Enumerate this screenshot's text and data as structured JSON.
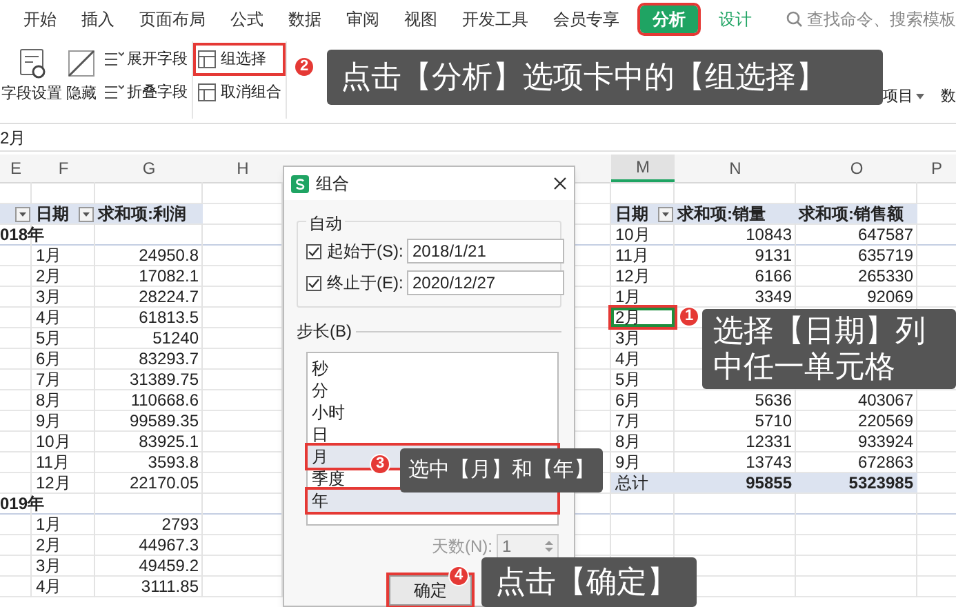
{
  "ribbon_tabs": [
    {
      "label": "开始",
      "kind": "tab",
      "selected": false,
      "highlighted": false
    },
    {
      "label": "插入",
      "kind": "tab",
      "selected": false,
      "highlighted": false
    },
    {
      "label": "页面布局",
      "kind": "tab",
      "selected": false,
      "highlighted": false
    },
    {
      "label": "公式",
      "kind": "tab",
      "selected": false,
      "highlighted": false
    },
    {
      "label": "数据",
      "kind": "tab",
      "selected": false,
      "highlighted": false
    },
    {
      "label": "审阅",
      "kind": "tab",
      "selected": false,
      "highlighted": false
    },
    {
      "label": "视图",
      "kind": "tab",
      "selected": false,
      "highlighted": false
    },
    {
      "label": "开发工具",
      "kind": "tab",
      "selected": false,
      "highlighted": false
    },
    {
      "label": "会员专享",
      "kind": "tab",
      "selected": false,
      "highlighted": false
    },
    {
      "label": "分析",
      "kind": "contextual",
      "selected": true,
      "highlighted": true
    },
    {
      "label": "设计",
      "kind": "contextual",
      "selected": false,
      "highlighted": false
    }
  ],
  "search": {
    "placeholder": "查找命令、搜索模板"
  },
  "ribbon_buttons": [
    {
      "label": "字段设置",
      "kind": "large",
      "highlighted": false
    },
    {
      "label": "隐藏",
      "kind": "large",
      "highlighted": false
    },
    {
      "label": "展开字段",
      "kind": "small",
      "highlighted": false
    },
    {
      "label": "折叠字段",
      "kind": "small",
      "highlighted": false
    },
    {
      "label": "组选择",
      "kind": "small",
      "highlighted": true
    },
    {
      "label": "取消组合",
      "kind": "small",
      "highlighted": false
    }
  ],
  "ribbon_right": [
    {
      "label": "项目",
      "dropdown": true
    },
    {
      "label": "数",
      "dropdown": false
    }
  ],
  "formula_bar": {
    "value": "2月"
  },
  "column_headers": [
    {
      "label": "E",
      "selected": false
    },
    {
      "label": "F",
      "selected": false
    },
    {
      "label": "G",
      "selected": false
    },
    {
      "label": "H",
      "selected": false
    },
    {
      "label": "M",
      "selected": true
    },
    {
      "label": "N",
      "selected": false
    },
    {
      "label": "O",
      "selected": false
    },
    {
      "label": "P",
      "selected": false
    }
  ],
  "left_pivot": {
    "columns": [
      "日期",
      "求和项:利润"
    ],
    "groups": [
      {
        "label": "018年",
        "rows": [
          {
            "label": "1月",
            "value": "24950.8"
          },
          {
            "label": "2月",
            "value": "17082.1"
          },
          {
            "label": "3月",
            "value": "28224.7"
          },
          {
            "label": "4月",
            "value": "61813.5"
          },
          {
            "label": "5月",
            "value": "51240"
          },
          {
            "label": "6月",
            "value": "83293.7"
          },
          {
            "label": "7月",
            "value": "31389.75"
          },
          {
            "label": "8月",
            "value": "110668.6"
          },
          {
            "label": "9月",
            "value": "99589.35"
          },
          {
            "label": "10月",
            "value": "83925.1"
          },
          {
            "label": "11月",
            "value": "3593.8"
          },
          {
            "label": "12月",
            "value": "22170.05"
          }
        ]
      },
      {
        "label": "019年",
        "rows": [
          {
            "label": "1月",
            "value": "2793"
          },
          {
            "label": "2月",
            "value": "44967.3"
          },
          {
            "label": "3月",
            "value": "49459.2"
          },
          {
            "label": "4月",
            "value": "3111.85"
          }
        ]
      }
    ]
  },
  "right_pivot": {
    "columns": [
      "日期",
      "求和项:销量",
      "求和项:销售额"
    ],
    "rows": [
      {
        "kind": "month",
        "label": "10月",
        "sales": "10843",
        "amount": "647587",
        "selected": false,
        "highlighted": false
      },
      {
        "kind": "month",
        "label": "11月",
        "sales": "9131",
        "amount": "635719",
        "selected": false,
        "highlighted": false
      },
      {
        "kind": "month",
        "label": "12月",
        "sales": "6166",
        "amount": "265330",
        "selected": false,
        "highlighted": false
      },
      {
        "kind": "month",
        "label": "1月",
        "sales": "3349",
        "amount": "92069",
        "selected": false,
        "highlighted": false
      },
      {
        "kind": "month",
        "label": "2月",
        "selected": true,
        "highlighted": true
      },
      {
        "kind": "month",
        "label": "3月",
        "selected": false,
        "highlighted": false
      },
      {
        "kind": "month",
        "label": "4月",
        "selected": false,
        "highlighted": false
      },
      {
        "kind": "month",
        "label": "5月",
        "selected": false,
        "highlighted": false
      },
      {
        "kind": "month",
        "label": "6月",
        "sales": "5636",
        "amount": "403067",
        "selected": false,
        "highlighted": false
      },
      {
        "kind": "month",
        "label": "7月",
        "sales": "5710",
        "amount": "220569",
        "selected": false,
        "highlighted": false
      },
      {
        "kind": "month",
        "label": "8月",
        "sales": "12331",
        "amount": "933924",
        "selected": false,
        "highlighted": false
      },
      {
        "kind": "month",
        "label": "9月",
        "sales": "13743",
        "amount": "672863",
        "selected": false,
        "highlighted": false
      },
      {
        "kind": "total",
        "label": "总计",
        "sales": "95855",
        "amount": "5323985",
        "selected": false,
        "highlighted": false
      }
    ]
  },
  "dialog": {
    "title": "组合",
    "auto_label": "自动",
    "fields": [
      {
        "label": "起始于(S):",
        "value": "2018/1/21",
        "checked": true
      },
      {
        "label": "终止于(E):",
        "value": "2020/12/27",
        "checked": true
      }
    ],
    "step_label": "步长(B)",
    "steps": [
      {
        "label": "秒",
        "selected": false,
        "highlighted": false
      },
      {
        "label": "分",
        "selected": false,
        "highlighted": false
      },
      {
        "label": "小时",
        "selected": false,
        "highlighted": false
      },
      {
        "label": "日",
        "selected": false,
        "highlighted": false
      },
      {
        "label": "月",
        "selected": true,
        "highlighted": true
      },
      {
        "label": "季度",
        "selected": false,
        "highlighted": false
      },
      {
        "label": "年",
        "selected": true,
        "highlighted": true
      }
    ],
    "days": {
      "label": "天数(N):",
      "value": "1",
      "disabled": true
    },
    "ok_button": {
      "label": "确定",
      "highlighted": true
    }
  },
  "callouts": [
    {
      "number": "2",
      "text": "点击【分析】选项卡中的【组选择】"
    },
    {
      "number": "1",
      "text": "选择【日期】列中任一单元格"
    },
    {
      "number": "3",
      "text": "选中【月】和【年】"
    },
    {
      "number": "4",
      "text": "点击【确定】"
    }
  ]
}
